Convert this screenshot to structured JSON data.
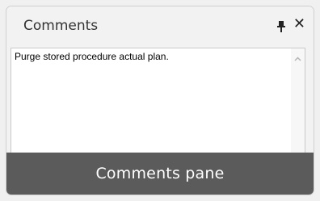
{
  "pane": {
    "title": "Comments",
    "pin_icon": "pin-icon",
    "close_label": "✕",
    "comment_text": "Purge stored procedure actual plan.",
    "scroll_up_icon": "chevron-up-icon"
  },
  "caption": {
    "text": "Comments pane"
  },
  "colors": {
    "caption_bg": "#5b5b5b",
    "panel_bg": "#f2f2f2",
    "textarea_bg": "#ffffff"
  }
}
